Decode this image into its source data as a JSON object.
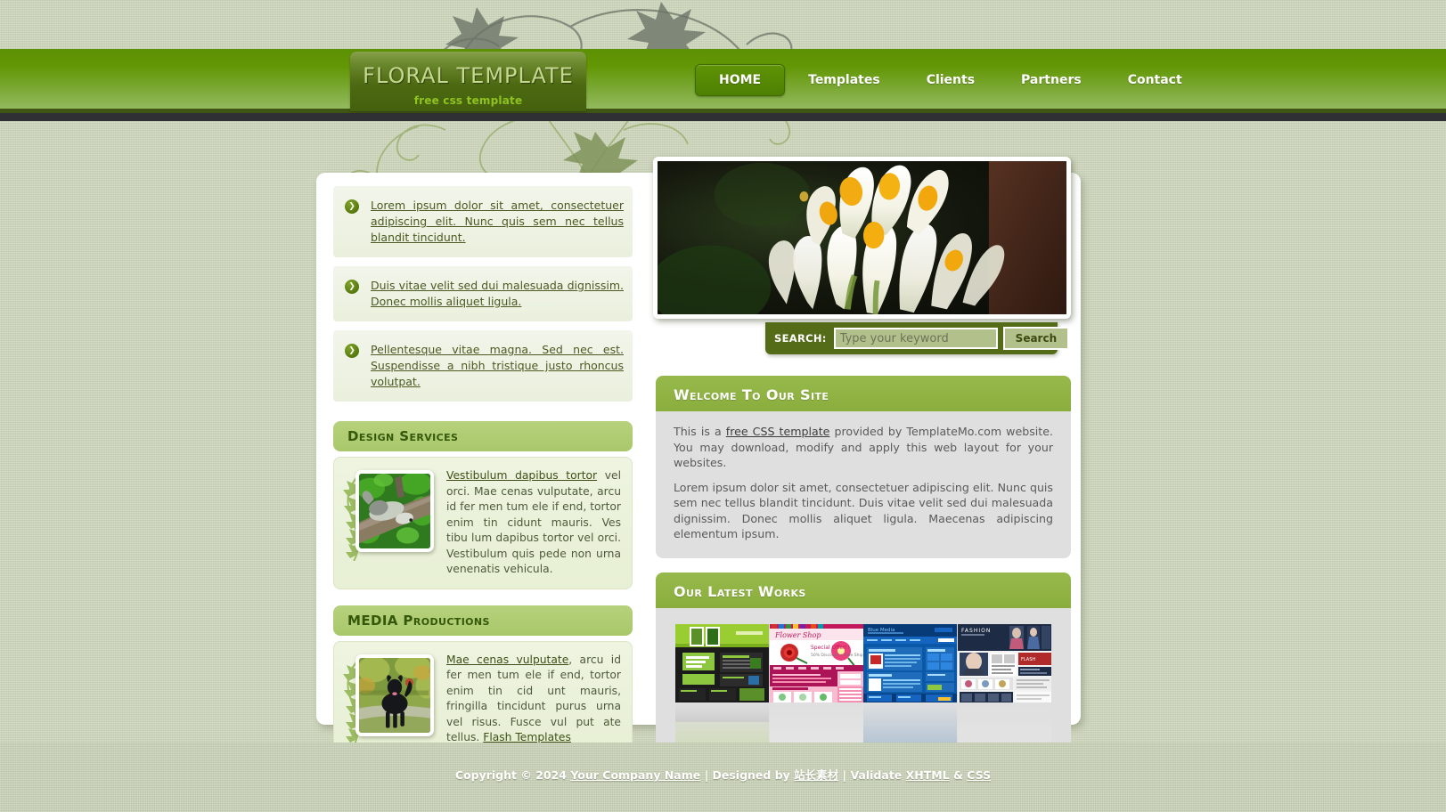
{
  "site": {
    "logo_title": "FLORAL TEMPLATE",
    "logo_tagline": "free css template"
  },
  "nav": {
    "items": [
      {
        "label": "HOME",
        "active": true
      },
      {
        "label": "Templates",
        "active": false
      },
      {
        "label": "Clients",
        "active": false
      },
      {
        "label": "Partners",
        "active": false
      },
      {
        "label": "Contact",
        "active": false
      }
    ]
  },
  "hero": {
    "alt": "white orchid flowers with yellow centers"
  },
  "search": {
    "label": "SEARCH:",
    "value": "",
    "placeholder": "Type your keyword",
    "button_label": "Search"
  },
  "feature_list": {
    "items": [
      {
        "text": "Lorem ipsum dolor sit amet, consectetuer adipiscing elit. Nunc quis sem nec tellus blandit tincidunt."
      },
      {
        "text": "Duis vitae velit sed dui malesuada dignissim. Donec mollis aliquet ligula."
      },
      {
        "text": "Pellentesque vitae magna. Sed nec est. Suspendisse a nibh tristique justo rhoncus volutpat."
      }
    ]
  },
  "sidebar_panels": [
    {
      "heading": "Design Services",
      "image_alt": "squirrel on tree branch",
      "link_text": "Vestibulum dapibus tortor",
      "body_text": " vel orci. Mae cenas vulputate, arcu id fer men tum ele if end, tortor enim tin cidunt mauris. Ves tibu lum dapibus tortor vel orci. Vestibulum quis pede non urna venenatis vehicula.",
      "trailing_link": ""
    },
    {
      "heading": "MEDIA Productions",
      "image_alt": "black dog in park",
      "link_text": "Mae cenas vulputate",
      "body_text": ", arcu id fer men tum ele if end, tortor enim tin cid unt mauris, fringilla tincidunt purus urna vel risus. Fusce vul put ate tellus. ",
      "trailing_link": "Flash Templates"
    }
  ],
  "welcome_panel": {
    "heading": "Welcome To Our Site",
    "paragraph1_pre": "This is a ",
    "paragraph1_link": "free CSS template",
    "paragraph1_post": " provided by TemplateMo.com website. You may download, modify and apply this web layout for your websites.",
    "paragraph2": "Lorem ipsum dolor sit amet, consectetuer adipiscing elit. Nunc quis sem nec tellus blandit tincidunt. Duis vitae velit sed dui malesuada dignissim. Donec mollis aliquet ligula. Maecenas adipiscing elementum ipsum."
  },
  "works_panel": {
    "heading": "Our Latest Works",
    "items": [
      {
        "alt": "green and black insect blog website thumbnail",
        "accent": "#8dc63f"
      },
      {
        "alt": "pink flower shop website thumbnail",
        "accent": "#d62a7a"
      },
      {
        "alt": "blue media website thumbnail",
        "accent": "#1060b8"
      },
      {
        "alt": "fashion magazine website thumbnail",
        "accent": "#1d2b44"
      }
    ]
  },
  "footer": {
    "copyright_pre": "Copyright © 2024 ",
    "company_link": "Your Company Name",
    "designed_by_pre": " | Designed by ",
    "designer_link": "站长素材",
    "validate_pre": " | Validate ",
    "xhtml_link": "XHTML",
    "amp": " & ",
    "css_link": "CSS"
  },
  "colors": {
    "page_bg": "#cdd6bb",
    "header_green_top": "#5d9105",
    "header_green_bottom": "#93b95e",
    "logo_bg": "#4d6a12",
    "accent_heading": "#8aae3d",
    "sidebar_heading": "#a9c86a",
    "search_bar": "#546b18",
    "panel_body": "#dfdfdf"
  }
}
